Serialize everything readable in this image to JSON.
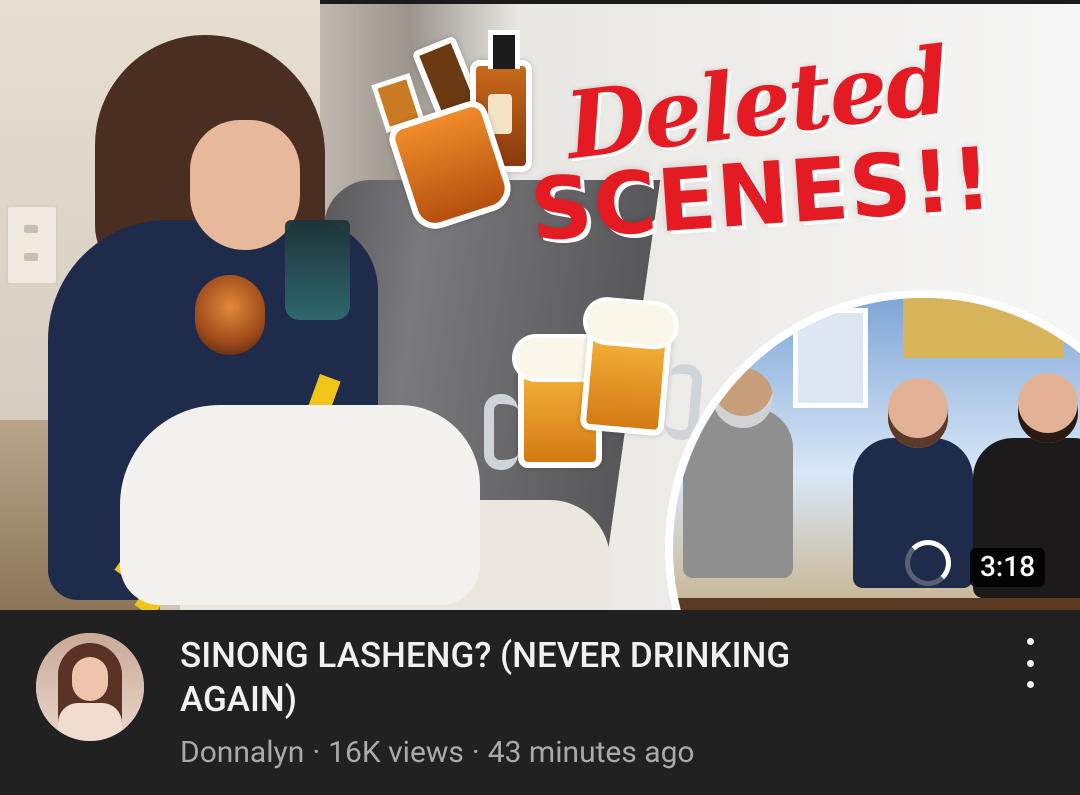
{
  "video": {
    "title": "SINONG LASHENG? (NEVER DRINKING AGAIN)",
    "channel": "Donnalyn",
    "views": "16K views",
    "age": "43 minutes ago",
    "separator": "·",
    "duration": "3:18"
  },
  "thumbnail": {
    "text_line1": "Deleted",
    "text_line2": "SCENES!!",
    "accent_color": "#e41b23"
  },
  "icons": {
    "more": "more-vert-icon",
    "loading": "loading-spinner-icon"
  },
  "colors": {
    "background": "#212121",
    "title": "#f1f1f1",
    "meta": "#aaaaaa"
  }
}
